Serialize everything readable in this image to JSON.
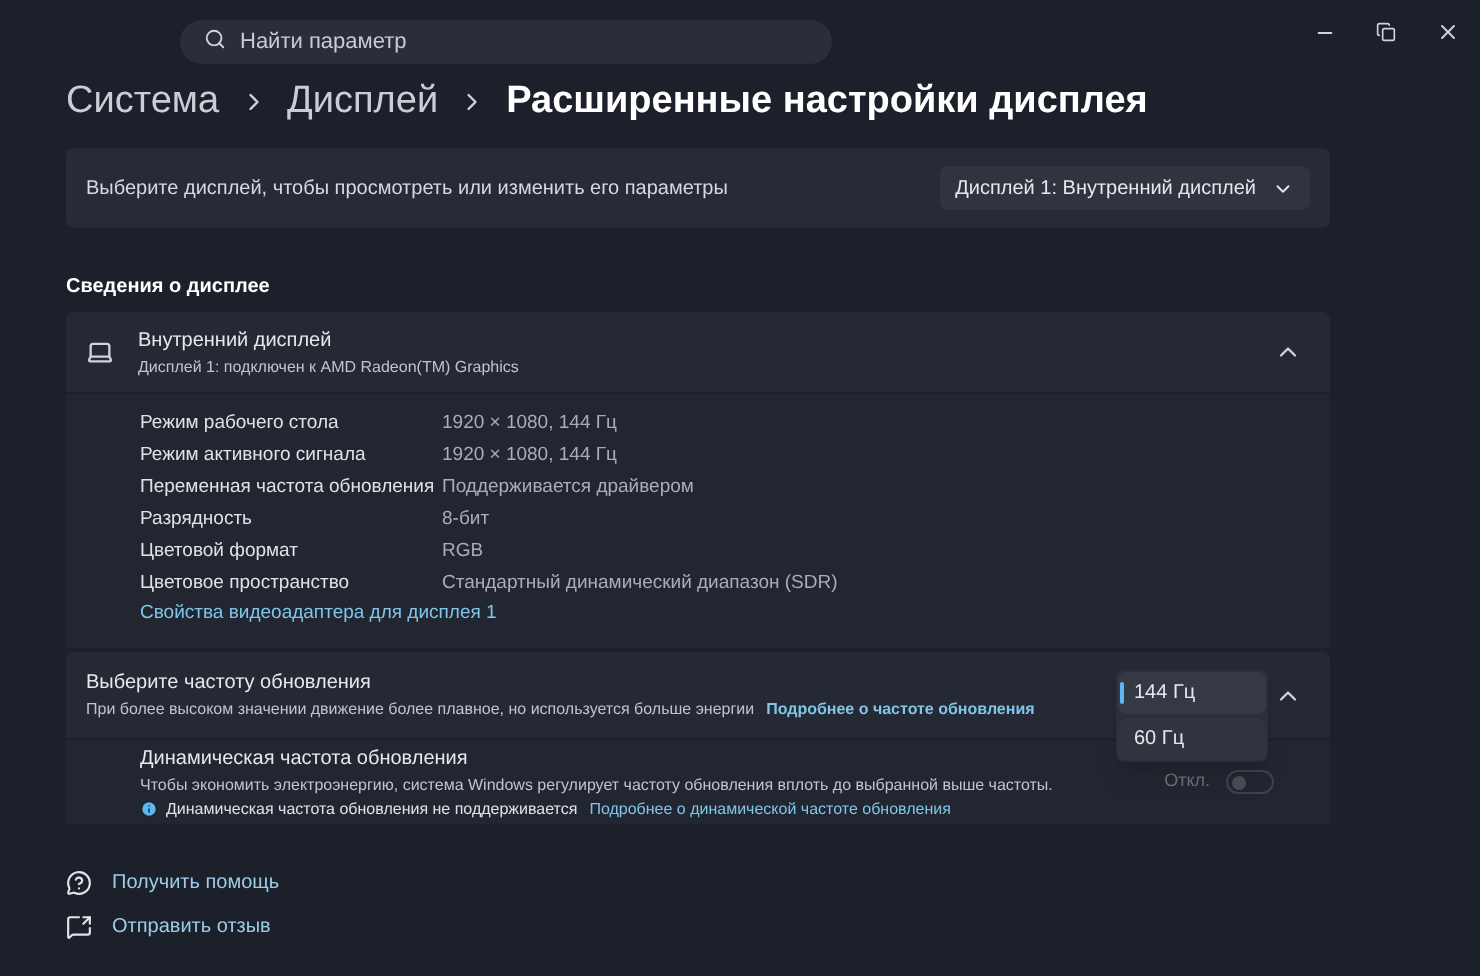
{
  "search": {
    "placeholder": "Найти параметр"
  },
  "breadcrumb": [
    "Система",
    "Дисплей",
    "Расширенные настройки дисплея"
  ],
  "display_select": {
    "label": "Выберите дисплей, чтобы просмотреть или изменить его параметры",
    "value": "Дисплей 1: Внутренний дисплей"
  },
  "section_title": "Сведения о дисплее",
  "display_info": {
    "title": "Внутренний дисплей",
    "subtitle": "Дисплей 1: подключен к AMD Radeon(TM) Graphics",
    "expanded": true,
    "rows": [
      {
        "label": "Режим рабочего стола",
        "value": "1920 × 1080, 144 Гц"
      },
      {
        "label": "Режим активного сигнала",
        "value": "1920 × 1080, 144 Гц"
      },
      {
        "label": "Переменная частота обновления",
        "value": "Поддерживается драйвером"
      },
      {
        "label": "Разрядность",
        "value": "8-бит"
      },
      {
        "label": "Цветовой формат",
        "value": "RGB"
      },
      {
        "label": "Цветовое пространство",
        "value": "Стандартный динамический диапазон (SDR)"
      }
    ],
    "link": "Свойства видеоадаптера для дисплея 1"
  },
  "refresh": {
    "title": "Выберите частоту обновления",
    "description": "При более высоком значении движение более плавное, но используется больше энергии",
    "link": "Подробнее о частоте обновления",
    "expanded": true,
    "options": [
      {
        "label": "144 Гц",
        "selected": true
      },
      {
        "label": "60 Гц",
        "selected": false
      }
    ],
    "dynamic": {
      "title": "Динамическая частота обновления",
      "description": "Чтобы экономить электроэнергию, система Windows регулирует частоту обновления вплоть до выбранной выше частоты.",
      "note": "Динамическая частота обновления не поддерживается",
      "link": "Подробнее о динамической частоте обновления",
      "state_label": "Откл.",
      "on": false,
      "disabled": true
    }
  },
  "footer_links": [
    {
      "kind": "help",
      "label": "Получить помощь"
    },
    {
      "kind": "feedback",
      "label": "Отправить отзыв"
    }
  ]
}
